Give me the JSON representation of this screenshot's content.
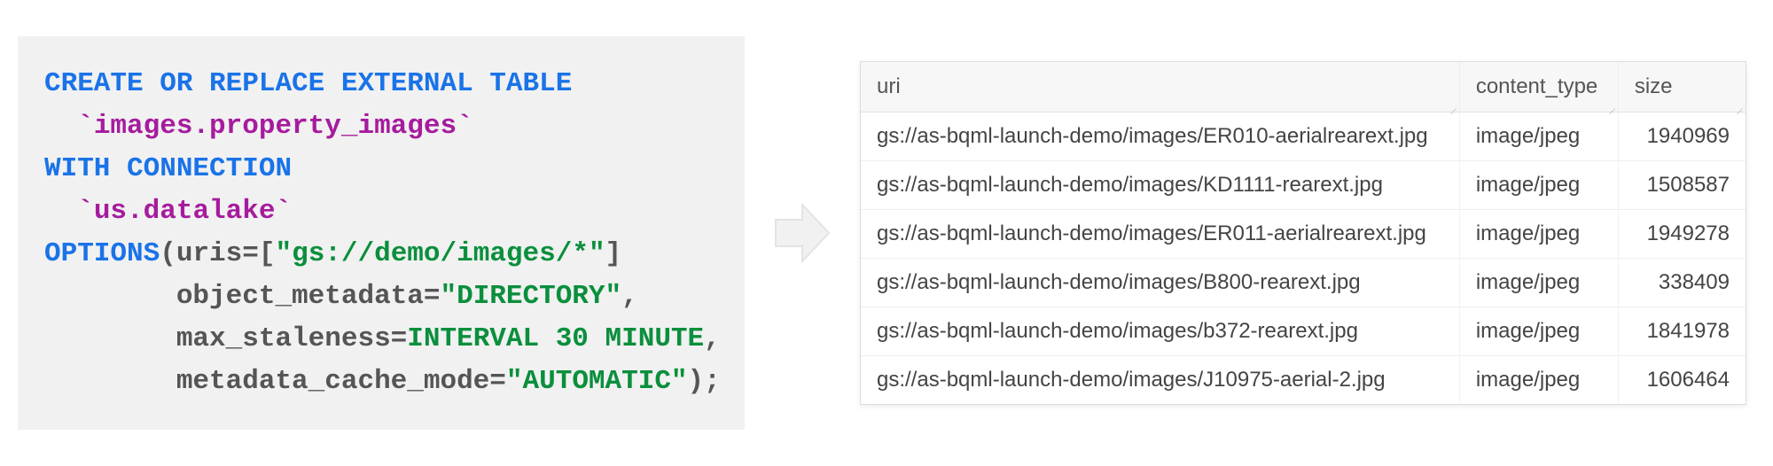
{
  "code": {
    "line1_kw": "CREATE OR REPLACE EXTERNAL TABLE",
    "line2_indent": "  ",
    "line2_tick1": "`",
    "line2_ident": "images.property_images",
    "line2_tick2": "`",
    "line3_kw": "WITH CONNECTION",
    "line4_indent": "  ",
    "line4_tick1": "`",
    "line4_ident": "us.datalake",
    "line4_tick2": "`",
    "line5_kw": "OPTIONS",
    "line5_open": "(",
    "line5_param": "uris",
    "line5_eq": "=[",
    "line5_str": "\"gs://demo/images/*\"",
    "line5_close": "]",
    "line6_indent": "        ",
    "line6_param": "object_metadata",
    "line6_eq": "=",
    "line6_str": "\"DIRECTORY\"",
    "line6_comma": ",",
    "line7_indent": "        ",
    "line7_param": "max_staleness",
    "line7_eq": "=",
    "line7_kw": "INTERVAL 30 MINUTE",
    "line7_comma": ",",
    "line8_indent": "        ",
    "line8_param": "metadata_cache_mode",
    "line8_eq": "=",
    "line8_str": "\"AUTOMATIC\"",
    "line8_close": ");"
  },
  "table": {
    "headers": {
      "uri": "uri",
      "content_type": "content_type",
      "size": "size"
    },
    "rows": [
      {
        "uri": "gs://as-bqml-launch-demo/images/ER010-aerialrearext.jpg",
        "content_type": "image/jpeg",
        "size": "1940969"
      },
      {
        "uri": "gs://as-bqml-launch-demo/images/KD1111-rearext.jpg",
        "content_type": "image/jpeg",
        "size": "1508587"
      },
      {
        "uri": "gs://as-bqml-launch-demo/images/ER011-aerialrearext.jpg",
        "content_type": "image/jpeg",
        "size": "1949278"
      },
      {
        "uri": "gs://as-bqml-launch-demo/images/B800-rearext.jpg",
        "content_type": "image/jpeg",
        "size": "338409"
      },
      {
        "uri": "gs://as-bqml-launch-demo/images/b372-rearext.jpg",
        "content_type": "image/jpeg",
        "size": "1841978"
      },
      {
        "uri": "gs://as-bqml-launch-demo/images/J10975-aerial-2.jpg",
        "content_type": "image/jpeg",
        "size": "1606464"
      }
    ]
  }
}
